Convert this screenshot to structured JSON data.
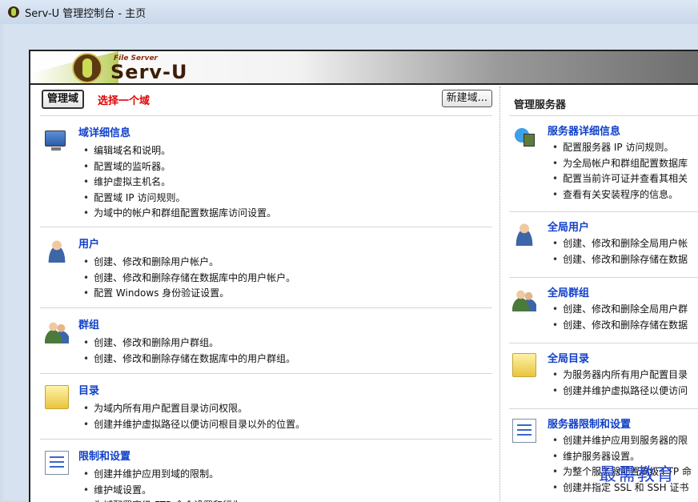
{
  "window": {
    "title": "Serv-U 管理控制台 - 主页"
  },
  "logo": {
    "tagline": "File Server",
    "name": "Serv-U"
  },
  "domain_bar": {
    "manage_label": "管理域",
    "select_prompt": "选择一个域",
    "new_label": "新建域..."
  },
  "left_sections": [
    {
      "title": "域详细信息",
      "items": [
        "编辑域名和说明。",
        "配置域的监听器。",
        "维护虚拟主机名。",
        "配置域 IP 访问规则。",
        "为域中的帐户和群组配置数据库访问设置。"
      ]
    },
    {
      "title": "用户",
      "items": [
        "创建、修改和删除用户帐户。",
        "创建、修改和删除存储在数据库中的用户帐户。",
        "配置 Windows 身份验证设置。"
      ]
    },
    {
      "title": "群组",
      "items": [
        "创建、修改和删除用户群组。",
        "创建、修改和删除存储在数据库中的用户群组。"
      ]
    },
    {
      "title": "目录",
      "items": [
        "为域内所有用户配置目录访问权限。",
        "创建并维护虚拟路径以便访问根目录以外的位置。"
      ]
    },
    {
      "title": "限制和设置",
      "items": [
        "创建并维护应用到域的限制。",
        "维护域设置。",
        "为域配置高级 FTP 命令设置和行为。"
      ]
    }
  ],
  "right_header": "管理服务器",
  "right_sections": [
    {
      "title": "服务器详细信息",
      "items": [
        "配置服务器 IP 访问规则。",
        "为全局帐户和群组配置数据库",
        "配置当前许可证并查看其相关",
        "查看有关安装程序的信息。"
      ]
    },
    {
      "title": "全局用户",
      "items": [
        "创建、修改和删除全局用户帐",
        "创建、修改和删除存储在数据"
      ]
    },
    {
      "title": "全局群组",
      "items": [
        "创建、修改和删除全局用户群",
        "创建、修改和删除存储在数据"
      ]
    },
    {
      "title": "全局目录",
      "items": [
        "为服务器内所有用户配置目录",
        "创建并维护虚拟路径以便访问"
      ]
    },
    {
      "title": "服务器限制和设置",
      "items": [
        "创建并维护应用到服务器的限",
        "维护服务器设置。",
        "为整个服务器配置高级 FTP 命",
        "创建并指定 SSL 和 SSH 证书"
      ]
    }
  ],
  "watermark": "最需教育",
  "icons": {
    "left": [
      "monitor-icon",
      "user-icon",
      "group-icon",
      "folder-icon",
      "checklist-icon"
    ],
    "right": [
      "server-globe-icon",
      "user-icon",
      "group-icon",
      "folder-icon",
      "checklist-icon"
    ]
  }
}
